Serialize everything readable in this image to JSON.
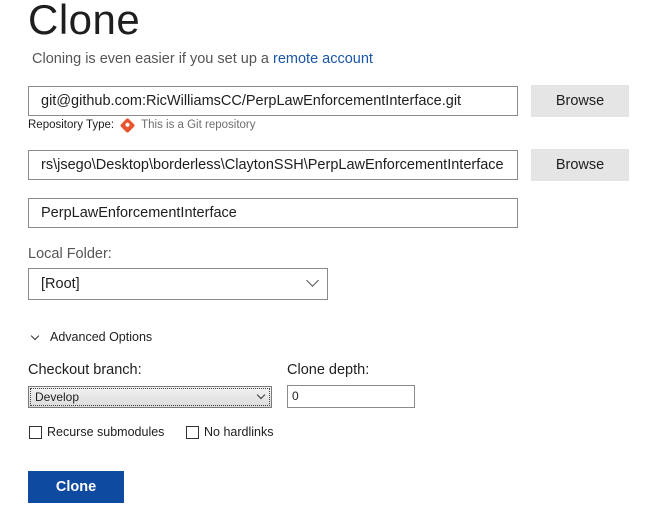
{
  "header": {
    "title": "Clone",
    "subtitle_prefix": "Cloning is even easier if you set up a",
    "subtitle_link": "remote account"
  },
  "repository": {
    "url": "git@github.com:RicWilliamsCC/PerpLawEnforcementInterface.git",
    "browse_label": "Browse",
    "type_label": "Repository Type:",
    "type_value": "This is a Git repository",
    "type_icon": "git-icon"
  },
  "clone_path": {
    "value": "rs\\jsego\\Desktop\\borderless\\ClaytonSSH\\PerpLawEnforcementInterface",
    "browse_label": "Browse"
  },
  "repo_name": {
    "value": "PerpLawEnforcementInterface"
  },
  "local_folder": {
    "label": "Local Folder:",
    "selected": "[Root]"
  },
  "advanced": {
    "label": "Advanced Options",
    "checkout_label": "Checkout branch:",
    "checkout_selected": "Develop",
    "clone_depth_label": "Clone depth:",
    "clone_depth_value": "0",
    "recurse_label": "Recurse submodules",
    "recurse_checked": false,
    "hardlinks_label": "No hardlinks",
    "hardlinks_checked": false
  },
  "actions": {
    "clone_label": "Clone"
  },
  "colors": {
    "accent": "#0e4aa0",
    "link": "#1a56a8",
    "git": "#e8552f"
  }
}
